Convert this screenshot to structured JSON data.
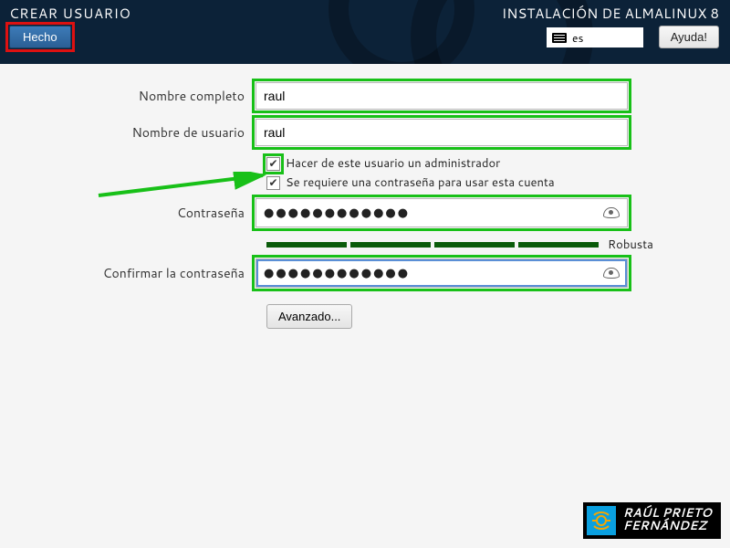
{
  "header": {
    "title": "CREAR USUARIO",
    "installer": "INSTALACIÓN DE ALMALINUX 8",
    "done_label": "Hecho",
    "keyboard_layout": "es",
    "help_label": "Ayuda!"
  },
  "form": {
    "fullname_label": "Nombre completo",
    "fullname_value": "raul",
    "username_label": "Nombre de usuario",
    "username_value": "raul",
    "admin_checkbox_label": "Hacer de este usuario un administrador",
    "admin_checked": true,
    "require_pw_checkbox_label": "Se requiere una contraseña para usar esta cuenta",
    "require_pw_checked": true,
    "password_label": "Contraseña",
    "password_mask": "●●●●●●●●●●●●",
    "confirm_label": "Confirmar la contraseña",
    "confirm_mask": "●●●●●●●●●●●●",
    "strength_label": "Robusta",
    "advanced_label": "Avanzado..."
  },
  "watermark": {
    "line1": "RAÚL PRIETO",
    "line2": "FERNÁNDEZ"
  },
  "annotations": {
    "done_highlight_color": "#d11",
    "field_highlight_color": "#18c018",
    "arrow_color": "#18c018"
  }
}
